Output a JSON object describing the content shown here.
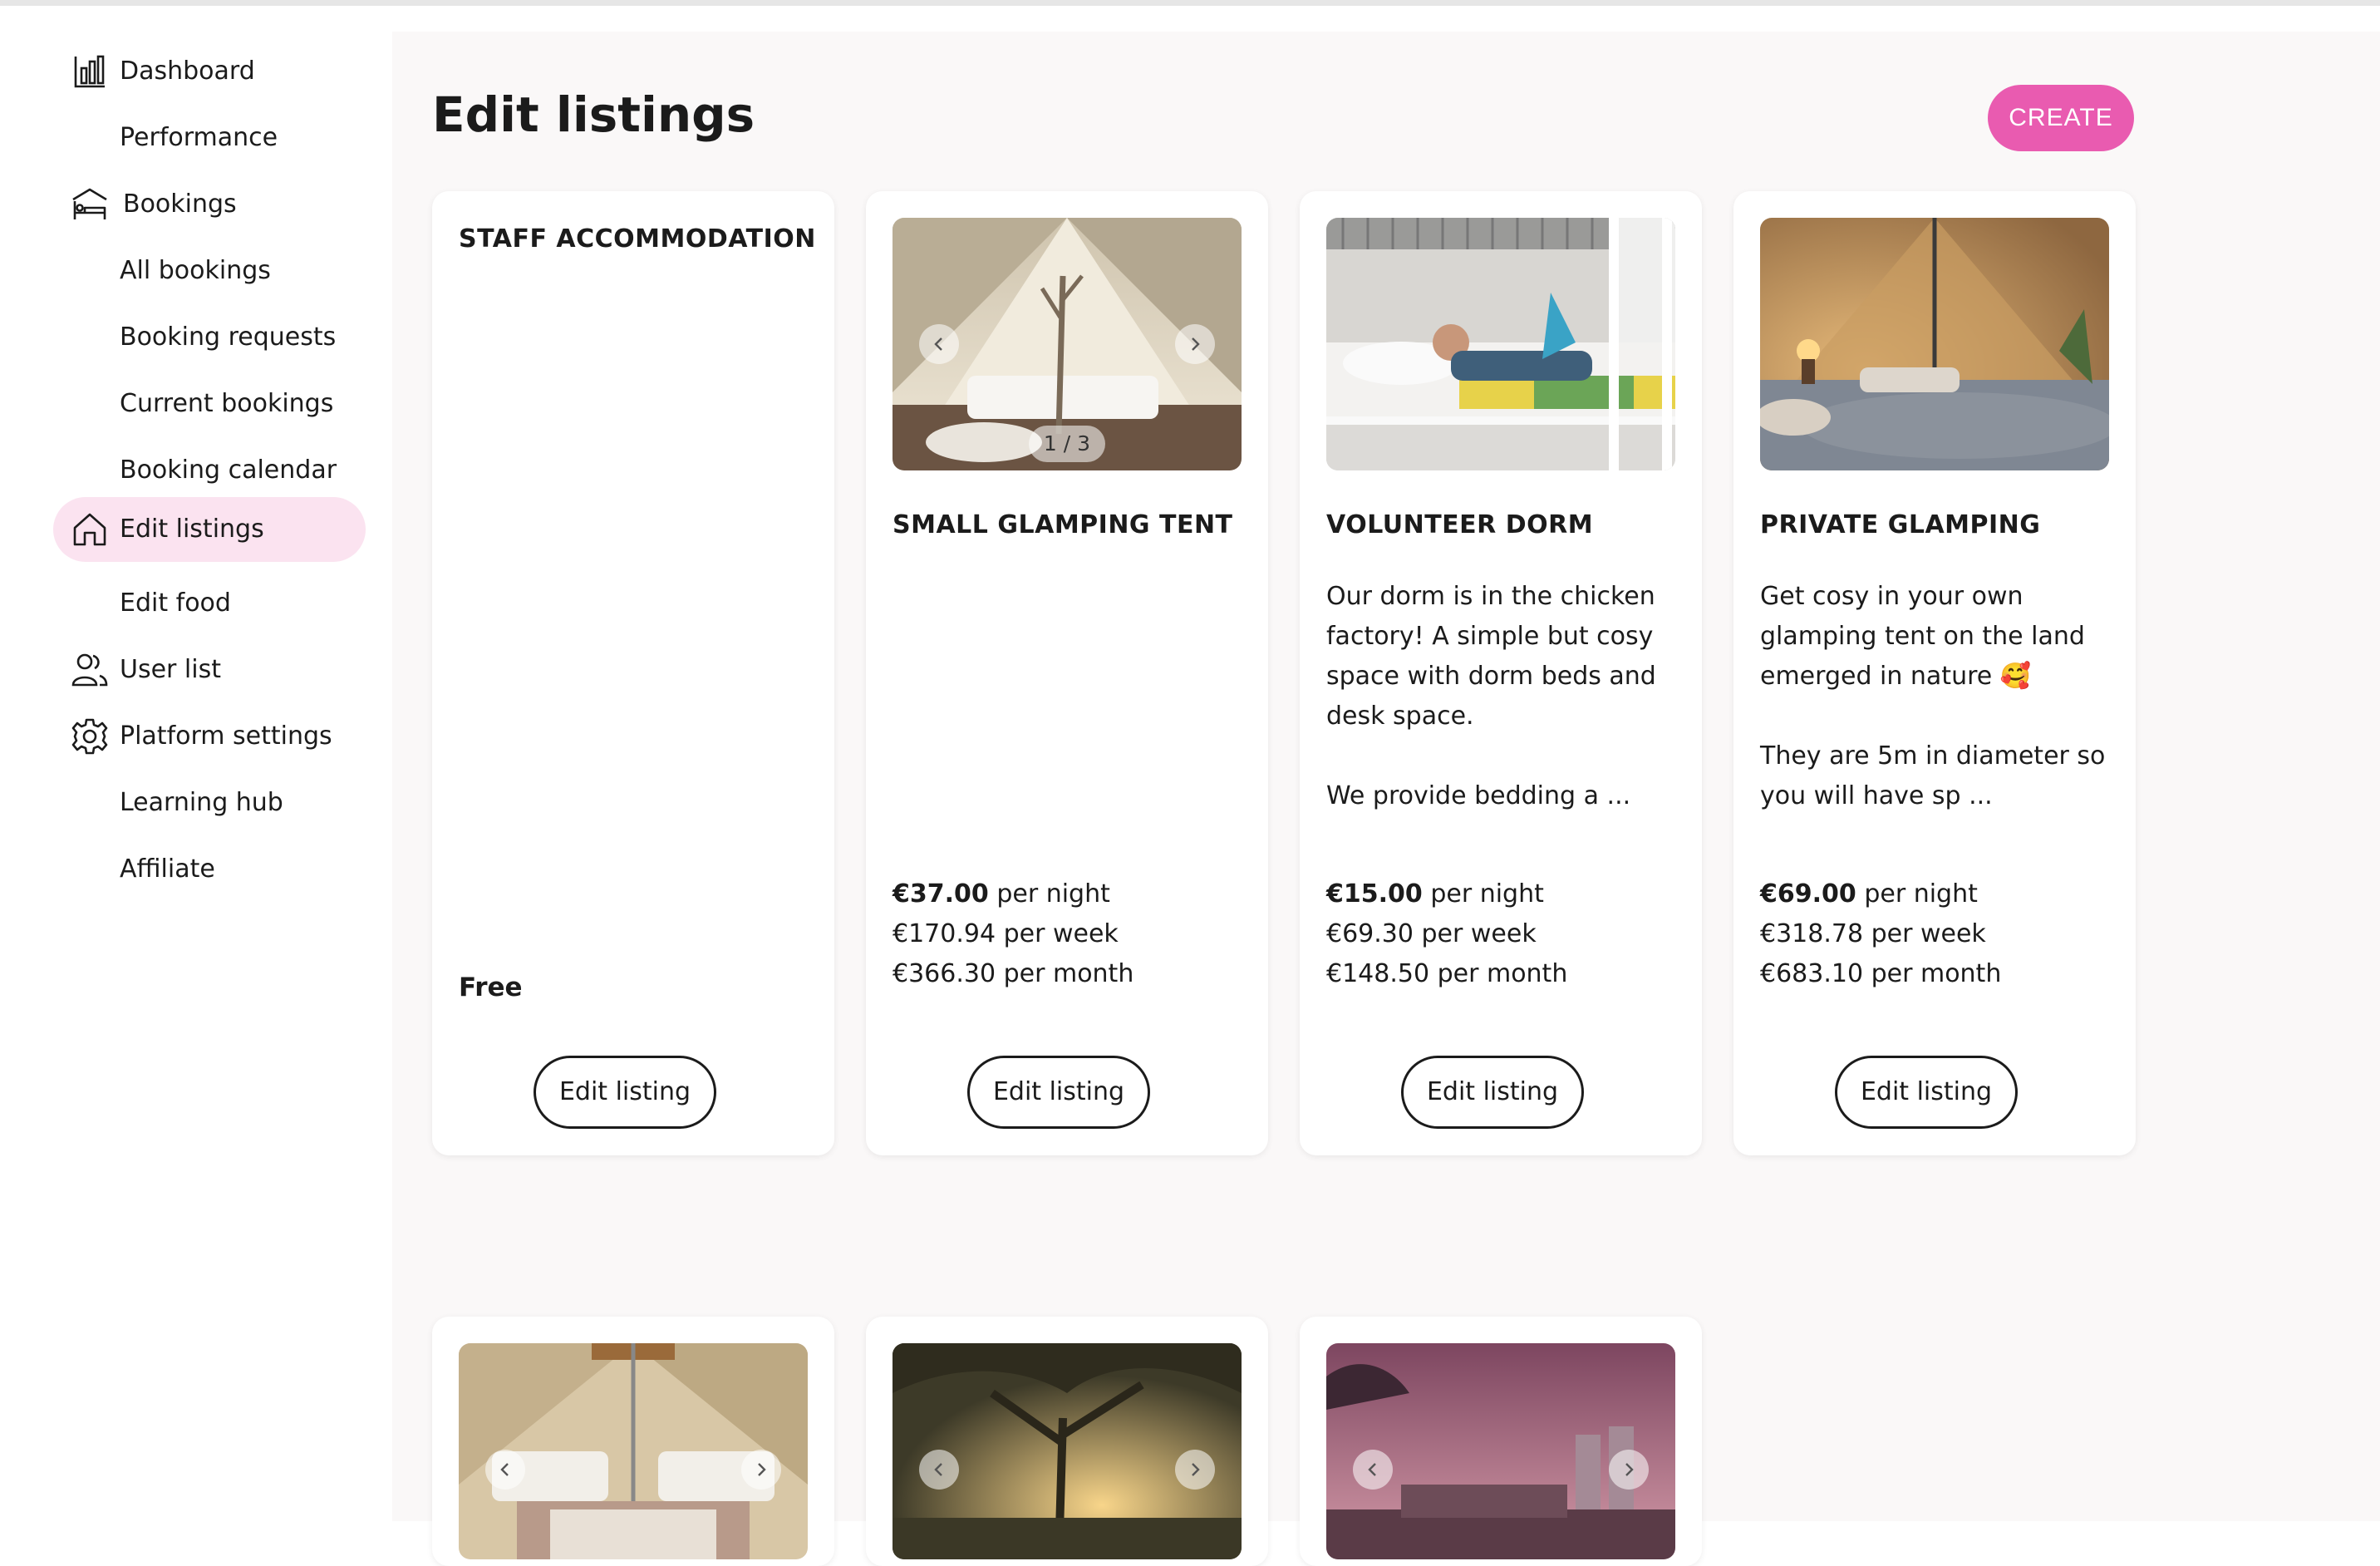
{
  "sidebar": {
    "items": [
      {
        "label": "Dashboard",
        "icon": "bar-chart-icon"
      },
      {
        "label": "Performance"
      },
      {
        "label": "Bookings",
        "icon": "bed-icon"
      },
      {
        "label": "All bookings"
      },
      {
        "label": "Booking requests"
      },
      {
        "label": "Current bookings"
      },
      {
        "label": "Booking calendar"
      },
      {
        "label": "Edit listings",
        "icon": "home-icon",
        "active": true
      },
      {
        "label": "Edit food"
      },
      {
        "label": "User list",
        "icon": "users-icon"
      },
      {
        "label": "Platform settings",
        "icon": "gear-icon"
      },
      {
        "label": "Learning hub"
      },
      {
        "label": "Affiliate"
      }
    ]
  },
  "header": {
    "title": "Edit listings",
    "create_label": "CREATE"
  },
  "colors": {
    "accent": "#e95bb0",
    "active_nav": "#fbe3f0",
    "background": "#faf8f8"
  },
  "listings": [
    {
      "title": "STAFF ACCOMMODATION",
      "price_label": "Free",
      "edit_label": "Edit listing"
    },
    {
      "title": "SMALL GLAMPING TENT",
      "image_counter": "1 / 3",
      "price_night": "€37.00",
      "per_night": " per night",
      "price_week": "€170.94 per week",
      "price_month": "€366.30 per month",
      "edit_label": "Edit listing"
    },
    {
      "title": "VOLUNTEER DORM",
      "desc_1": "Our dorm is in the chicken factory! A simple but cosy space with dorm beds and desk space.",
      "desc_2": "We provide bedding a ...",
      "price_night": "€15.00",
      "per_night": " per night",
      "price_week": "€69.30 per week",
      "price_month": "€148.50 per month",
      "edit_label": "Edit listing"
    },
    {
      "title": "PRIVATE GLAMPING",
      "desc_1": "Get cosy in your own glamping tent on the land emerged in nature 🥰",
      "desc_2": "They are 5m in diameter so you will have sp ...",
      "price_night": "€69.00",
      "per_night": " per night",
      "price_week": "€318.78 per week",
      "price_month": "€683.10 per month",
      "edit_label": "Edit listing"
    }
  ]
}
